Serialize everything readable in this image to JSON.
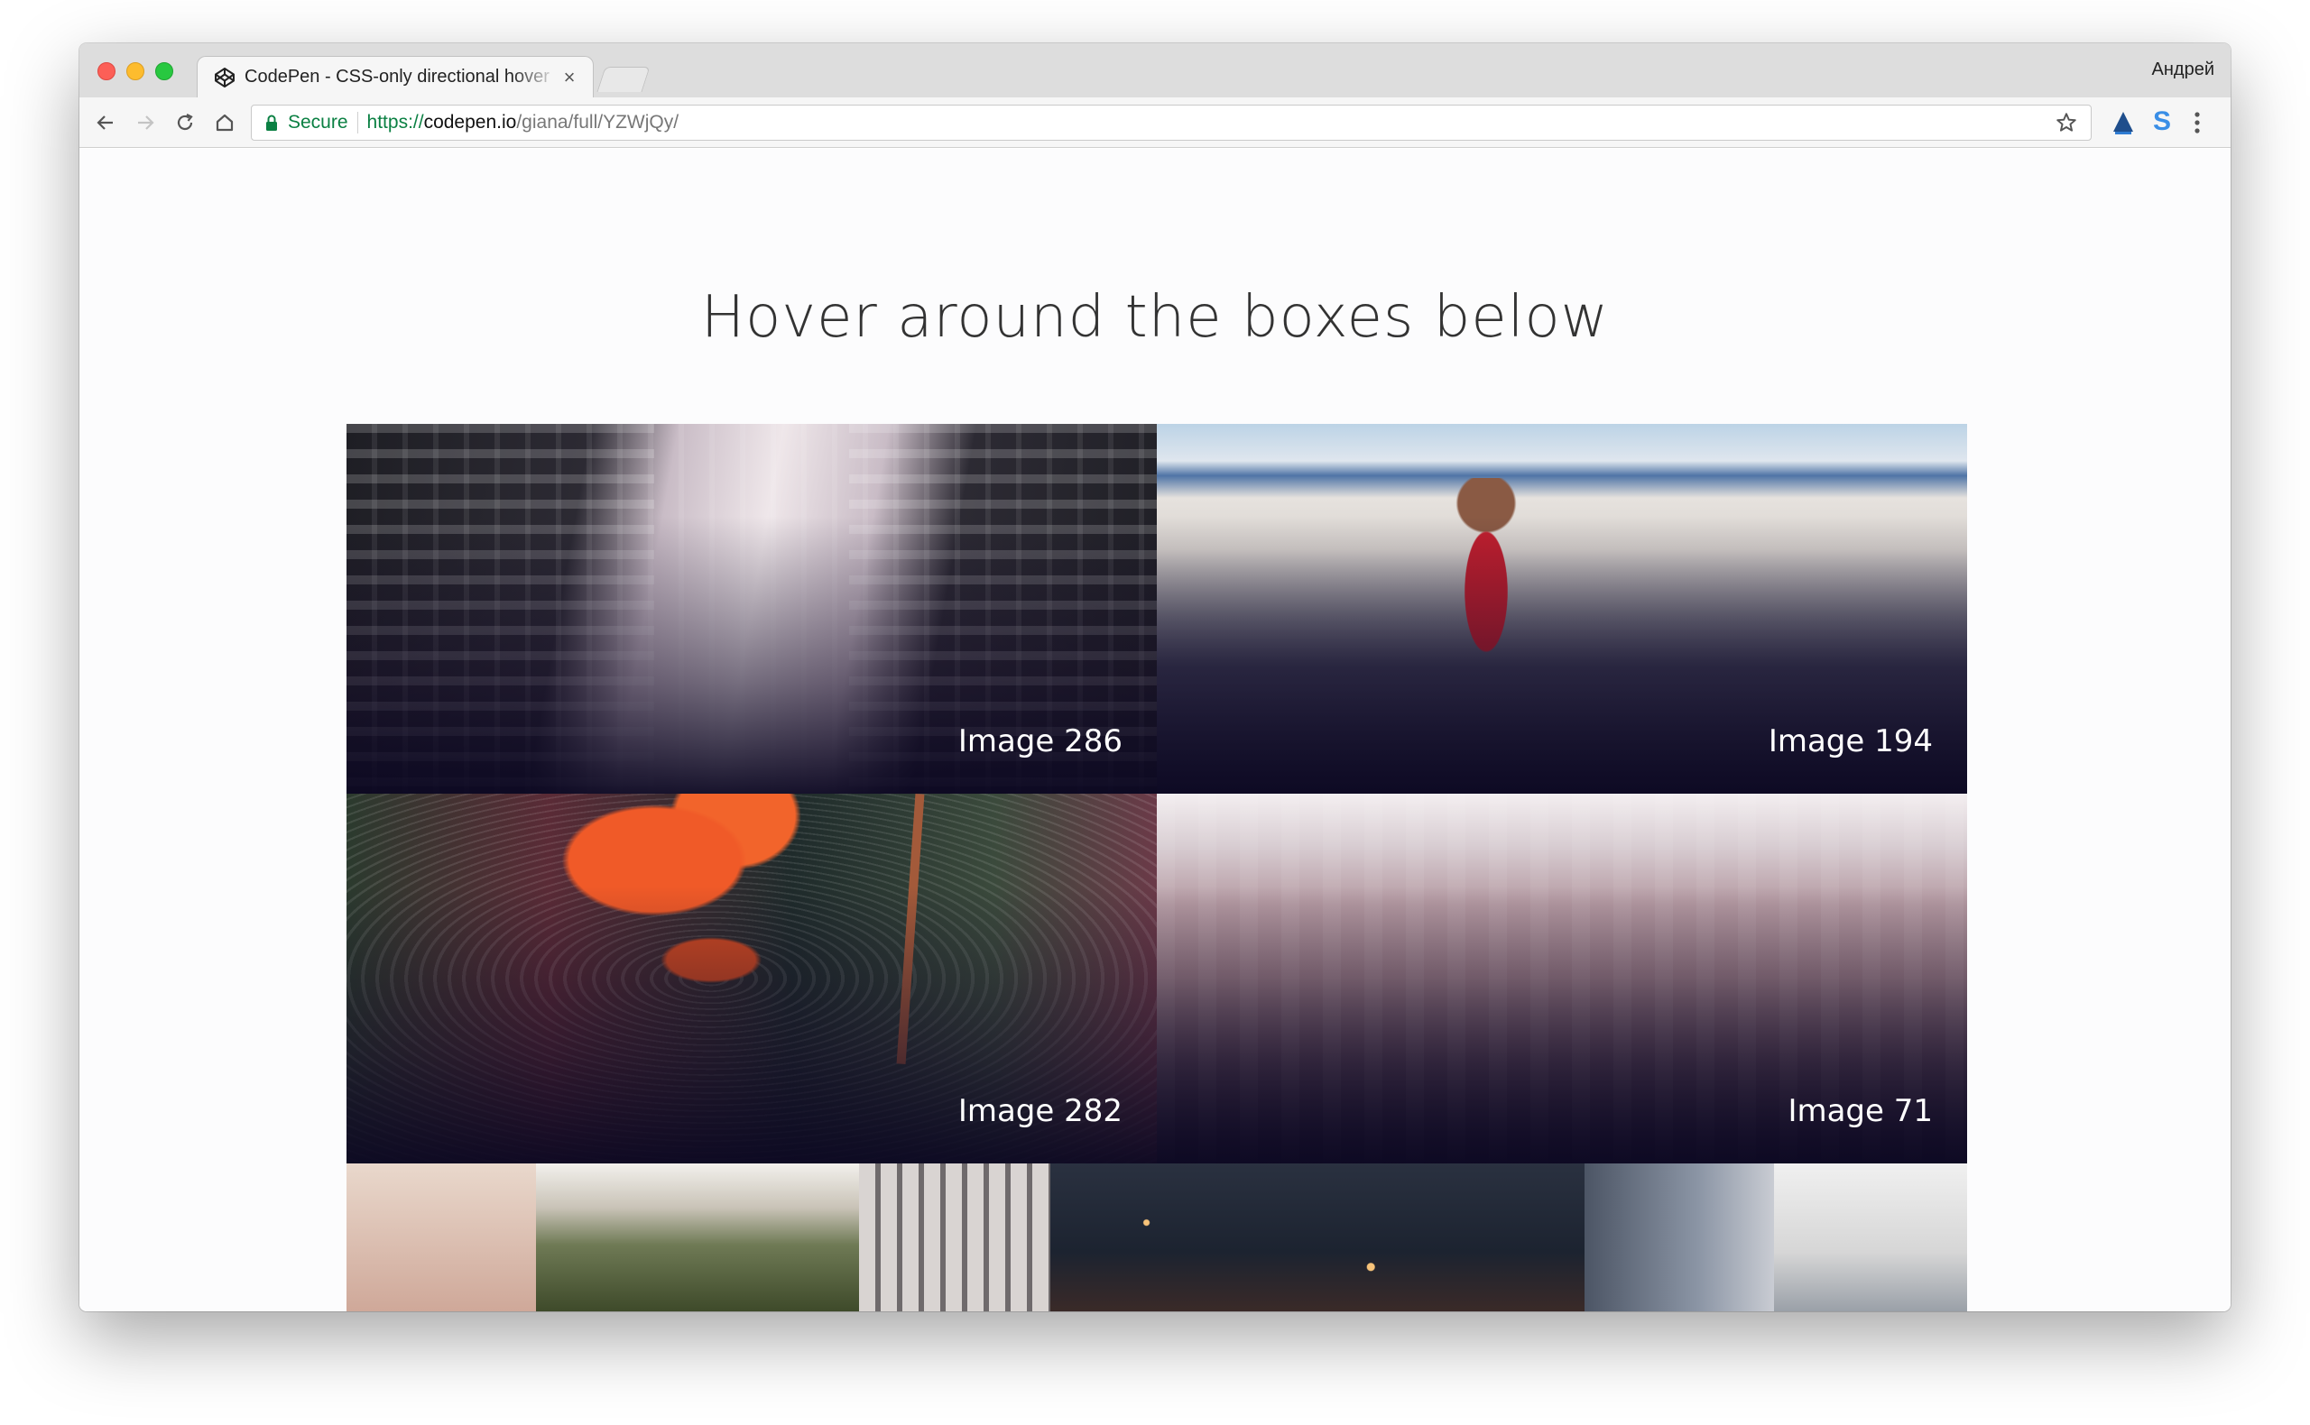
{
  "browser": {
    "tab": {
      "title": "CodePen - CSS-only directional hover",
      "close_glyph": "×"
    },
    "profile_name": "Андрей",
    "address": {
      "secure_label": "Secure",
      "scheme": "https://",
      "host": "codepen.io",
      "path": "/giana/full/YZWjQy/"
    },
    "accent_colors": {
      "secure_green": "#0b8043",
      "extension_blue": "#3a8ee6"
    }
  },
  "page": {
    "heading": "Hover around the boxes below",
    "boxes": [
      {
        "label": "Image 286"
      },
      {
        "label": "Image 194"
      },
      {
        "label": "Image 282"
      },
      {
        "label": "Image 71"
      }
    ]
  }
}
